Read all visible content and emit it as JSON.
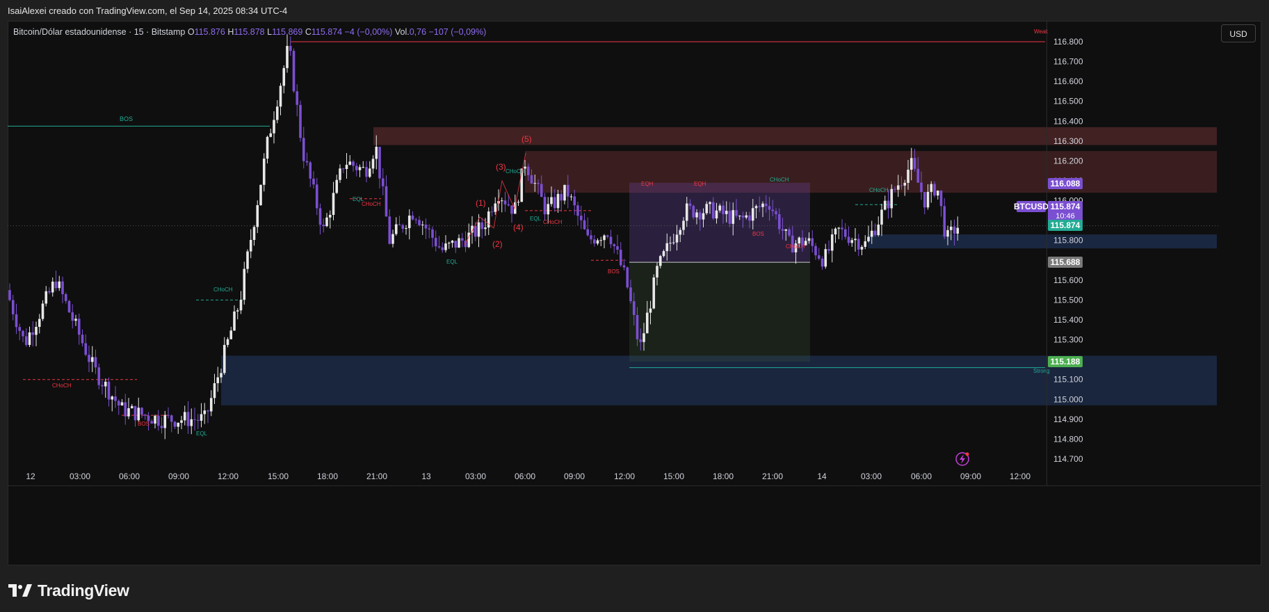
{
  "header": {
    "author_line": "IsaiAlexei creado con TradingView.com, el Sep 14, 2025 08:34 UTC-4"
  },
  "legend": {
    "symbol": "Bitcoin/Dólar estadounidense · 15 · Bitstamp",
    "o_label": "O",
    "o": "115.876",
    "h_label": "H",
    "h": "115.878",
    "l_label": "L",
    "l": "115.869",
    "c_label": "C",
    "c": "115.874",
    "change": "−4 (−0,00%)",
    "vol_label": "Vol.",
    "vol": "0,76",
    "vol_change": "−107 (−0,09%)"
  },
  "currency_button": "USD",
  "brand": {
    "name": "TradingView"
  },
  "colors": {
    "up": "#e8e8e8",
    "down": "#7b4fd1",
    "bull_zone": "#1c2a47",
    "bear_zone": "#4a2426",
    "accent": "#7b4fd1",
    "green": "#22ab94",
    "red": "#f23645"
  },
  "chart_data": {
    "type": "candlestick",
    "symbol": "BTCUSD",
    "timeframe": "15",
    "ylim": [
      114650,
      116850
    ],
    "y_ticks": [
      "116.800",
      "116.700",
      "116.600",
      "116.500",
      "116.400",
      "116.300",
      "116.200",
      "116.100",
      "116.000",
      "115.900",
      "115.800",
      "115.700",
      "115.600",
      "115.500",
      "115.400",
      "115.300",
      "115.200",
      "115.100",
      "115.000",
      "114.900",
      "114.800",
      "114.700"
    ],
    "x_ticks": [
      "12",
      "03:00",
      "06:00",
      "09:00",
      "12:00",
      "15:00",
      "18:00",
      "21:00",
      "13",
      "03:00",
      "06:00",
      "09:00",
      "12:00",
      "15:00",
      "18:00",
      "21:00",
      "14",
      "03:00",
      "06:00",
      "09:00",
      "12:00"
    ],
    "price_labels": {
      "zone_top": "116.088",
      "symbol_tag": "BTCUSD",
      "last": "115.874",
      "countdown": "10:46",
      "last_green": "115.874",
      "gray": "115.688",
      "zone_low": "115.188"
    },
    "annotations": {
      "weak": "Weak",
      "strong": "Strong",
      "bos": "BOS",
      "choch": "CHoCH",
      "eql": "EQL",
      "eqh": "EQH",
      "waves": [
        "(1)",
        "(2)",
        "(3)",
        "(4)",
        "(5)"
      ]
    },
    "key_prices": {
      "session_high": 116800,
      "weak_high": 116800,
      "strong_low": 115160,
      "last": 115874
    },
    "candles_ohlc_approx": [
      [
        115600,
        115620,
        115300,
        115350
      ],
      [
        115350,
        115420,
        115200,
        115300
      ],
      [
        115300,
        115400,
        115250,
        115380
      ],
      [
        115380,
        115400,
        115200,
        115250
      ],
      [
        115250,
        115420,
        115150,
        115400
      ],
      [
        115400,
        115480,
        115350,
        115460
      ],
      [
        115460,
        115550,
        115400,
        115500
      ],
      [
        115500,
        115620,
        115450,
        115600
      ],
      [
        115600,
        115680,
        115480,
        115520
      ],
      [
        115520,
        115540,
        115350,
        115380
      ],
      [
        115380,
        115400,
        115250,
        115300
      ],
      [
        115300,
        115320,
        115150,
        115200
      ],
      [
        115200,
        115260,
        115100,
        115150
      ],
      [
        115150,
        115180,
        115050,
        115080
      ],
      [
        115080,
        115120,
        114950,
        115000
      ],
      [
        115000,
        115080,
        114900,
        115050
      ],
      [
        115050,
        115120,
        115000,
        115080
      ],
      [
        115080,
        115100,
        114980,
        115000
      ],
      [
        115000,
        115150,
        114950,
        115120
      ],
      [
        115120,
        115200,
        115050,
        115080
      ],
      [
        115080,
        115100,
        114780,
        114900
      ],
      [
        114900,
        115000,
        114850,
        114980
      ],
      [
        114980,
        115150,
        114950,
        115120
      ],
      [
        115120,
        115250,
        115050,
        115200
      ],
      [
        115200,
        115280,
        115000,
        115050
      ],
      [
        115050,
        115150,
        114950,
        115100
      ],
      [
        115100,
        115300,
        115050,
        115250
      ],
      [
        115250,
        115350,
        114900,
        114950
      ],
      [
        114950,
        115250,
        114880,
        115200
      ],
      [
        115200,
        115350,
        115150,
        115300
      ],
      [
        115300,
        115400,
        115200,
        115380
      ],
      [
        115380,
        115480,
        115300,
        115450
      ],
      [
        115450,
        115600,
        115400,
        115550
      ],
      [
        115550,
        115800,
        115500,
        115780
      ],
      [
        115780,
        115950,
        115700,
        115920
      ],
      [
        115920,
        116120,
        115880,
        116080
      ],
      [
        116080,
        116300,
        116050,
        116250
      ],
      [
        116250,
        116500,
        116200,
        116480
      ],
      [
        116480,
        116650,
        116400,
        116600
      ],
      [
        116600,
        116800,
        116550,
        116780
      ],
      [
        116780,
        116800,
        116250,
        116350
      ],
      [
        116350,
        116400,
        116150,
        116200
      ],
      [
        116200,
        116300,
        116000,
        116150
      ],
      [
        116150,
        116200,
        115900,
        115950
      ],
      [
        115950,
        116050,
        115850,
        115900
      ],
      [
        115900,
        116180,
        115880,
        116150
      ],
      [
        116150,
        116250,
        116050,
        116100
      ],
      [
        116100,
        116200,
        115950,
        116000
      ],
      [
        116000,
        116100,
        115980,
        116080
      ],
      [
        116080,
        116350,
        116050,
        116300
      ],
      [
        116300,
        116350,
        116150,
        116200
      ],
      [
        116200,
        116250,
        115950,
        115980
      ],
      [
        115980,
        116050,
        115750,
        115800
      ],
      [
        115800,
        115900,
        115700,
        115850
      ],
      [
        115850,
        115950,
        115800,
        115900
      ],
      [
        115900,
        115950,
        115820,
        115850
      ],
      [
        115850,
        115900,
        115780,
        115800
      ],
      [
        115800,
        115850,
        115720,
        115750
      ],
      [
        115750,
        115850,
        115700,
        115820
      ],
      [
        115820,
        115900,
        115780,
        115860
      ]
    ]
  }
}
